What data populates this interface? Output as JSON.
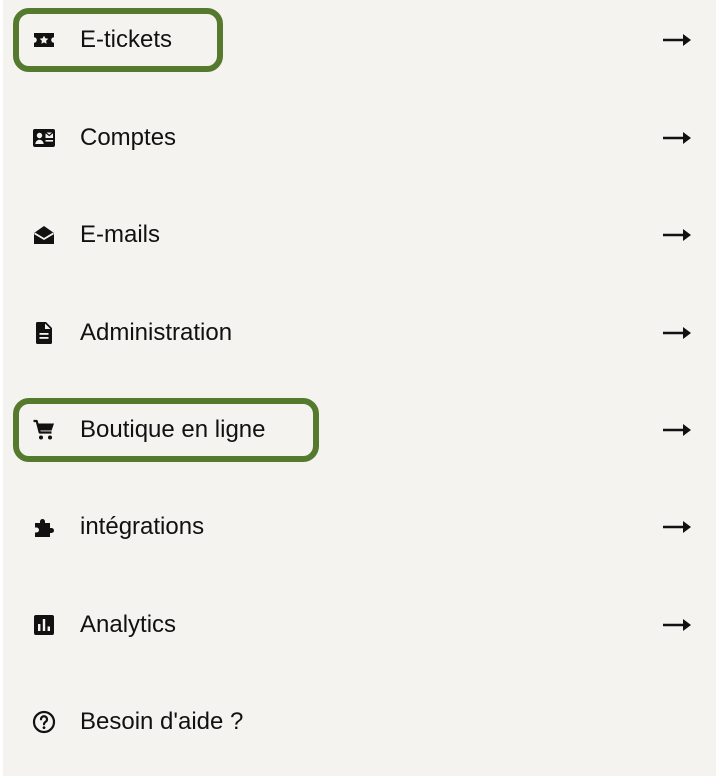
{
  "menu": {
    "items": [
      {
        "label": "E-tickets",
        "icon": "ticket-star-icon",
        "highlighted": true,
        "has_arrow": true
      },
      {
        "label": "Comptes",
        "icon": "contact-card-icon",
        "highlighted": false,
        "has_arrow": true
      },
      {
        "label": "E-mails",
        "icon": "open-envelope-icon",
        "highlighted": false,
        "has_arrow": true
      },
      {
        "label": "Administration",
        "icon": "document-icon",
        "highlighted": false,
        "has_arrow": true
      },
      {
        "label": "Boutique en ligne",
        "icon": "shopping-cart-icon",
        "highlighted": true,
        "has_arrow": true
      },
      {
        "label": "intégrations",
        "icon": "puzzle-piece-icon",
        "highlighted": false,
        "has_arrow": true
      },
      {
        "label": "Analytics",
        "icon": "bar-chart-icon",
        "highlighted": false,
        "has_arrow": true
      },
      {
        "label": "Besoin d'aide ?",
        "icon": "help-circle-icon",
        "highlighted": false,
        "has_arrow": false
      }
    ]
  },
  "colors": {
    "panel_background": "#f4f3ef",
    "highlight_border": "#557a2d",
    "text": "#111111"
  }
}
